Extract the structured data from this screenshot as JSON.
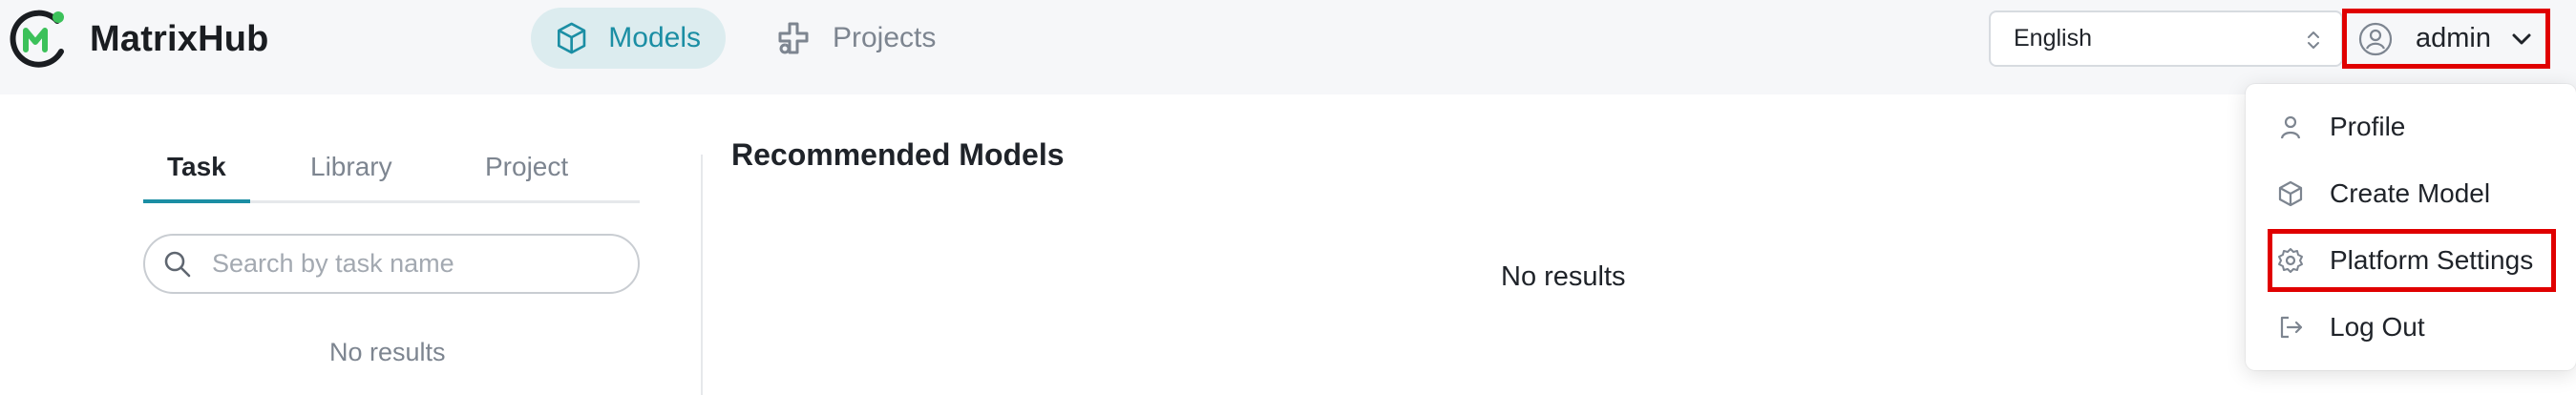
{
  "header": {
    "brand": "MatrixHub",
    "nav": {
      "models_label": "Models",
      "projects_label": "Projects"
    },
    "language": {
      "selected": "English"
    },
    "user": {
      "name": "admin"
    }
  },
  "left_panel": {
    "tabs": [
      {
        "label": "Task"
      },
      {
        "label": "Library"
      },
      {
        "label": "Project"
      }
    ],
    "search": {
      "placeholder": "Search by task name",
      "value": ""
    },
    "empty_text": "No results"
  },
  "main": {
    "title": "Recommended Models",
    "empty_text": "No results"
  },
  "user_menu": {
    "items": [
      {
        "label": "Profile",
        "icon": "person-icon"
      },
      {
        "label": "Create Model",
        "icon": "cube-icon"
      },
      {
        "label": "Platform Settings",
        "icon": "gear-icon"
      },
      {
        "label": "Log Out",
        "icon": "logout-icon"
      }
    ]
  },
  "colors": {
    "accent": "#1b8ea4",
    "accent_bg": "#dcecef",
    "logo_green": "#3cc15a",
    "highlight_red": "#e00000"
  }
}
